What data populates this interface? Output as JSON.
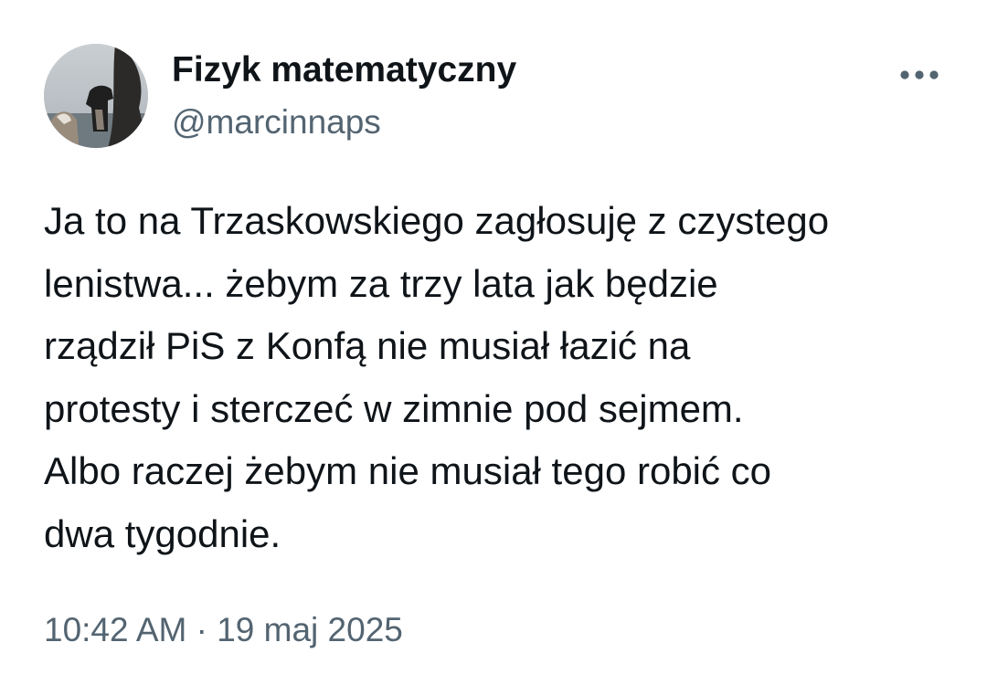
{
  "author": {
    "display_name": "Fizyk matematyczny",
    "handle": "@marcinnaps",
    "avatar": "avatar-photo-dogs-by-sea"
  },
  "more_button": {
    "icon": "more-horizontal-icon"
  },
  "tweet": {
    "text": "Ja to na Trzaskowskiego zagłosuję z czystego\nlenistwa... żebym za trzy lata jak będzie\nrządził PiS z Konfą nie musiał łazić na\nprotesty i sterczeć w zimnie pod sejmem.\nAlbo raczej żebym nie musiał tego robić co\ndwa tygodnie.",
    "timestamp": "10:42 AM · 19 maj 2025"
  },
  "colors": {
    "text_primary": "#0f1419",
    "text_secondary": "#536471",
    "background": "#ffffff"
  }
}
